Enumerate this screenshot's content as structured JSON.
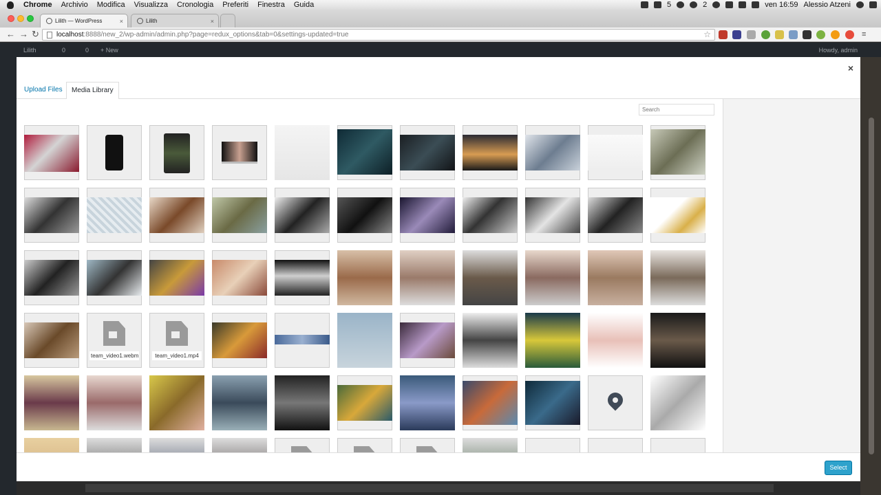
{
  "menubar": {
    "app": "Chrome",
    "items": [
      "Archivio",
      "Modifica",
      "Visualizza",
      "Cronologia",
      "Preferiti",
      "Finestra",
      "Guida"
    ],
    "right": {
      "a_count": "5",
      "b_count": "2",
      "clock": "ven 16:59",
      "user": "Alessio Atzeni"
    }
  },
  "browser": {
    "tabs": [
      {
        "label": "Lilith — WordPress"
      },
      {
        "label": "Lilith"
      }
    ],
    "url_host": "localhost",
    "url_rest": ":8888/new_2/wp-admin/admin.php?page=redux_options&tab=0&settings-updated=true"
  },
  "wpbar": {
    "site": "Lilith",
    "updates": "0",
    "comments": "0",
    "new": "+ New",
    "howdy": "Howdy, admin"
  },
  "modal": {
    "close": "×",
    "tabs": {
      "upload": "Upload Files",
      "library": "Media Library"
    },
    "search_placeholder": "Search",
    "select_button": "Select",
    "files": {
      "video1": "team_video1.webm",
      "video2": "team_video1.mp4"
    }
  },
  "colors": {
    "accent": "#2ea2cc",
    "link": "#0073aa",
    "admin_bar": "#23282d"
  }
}
